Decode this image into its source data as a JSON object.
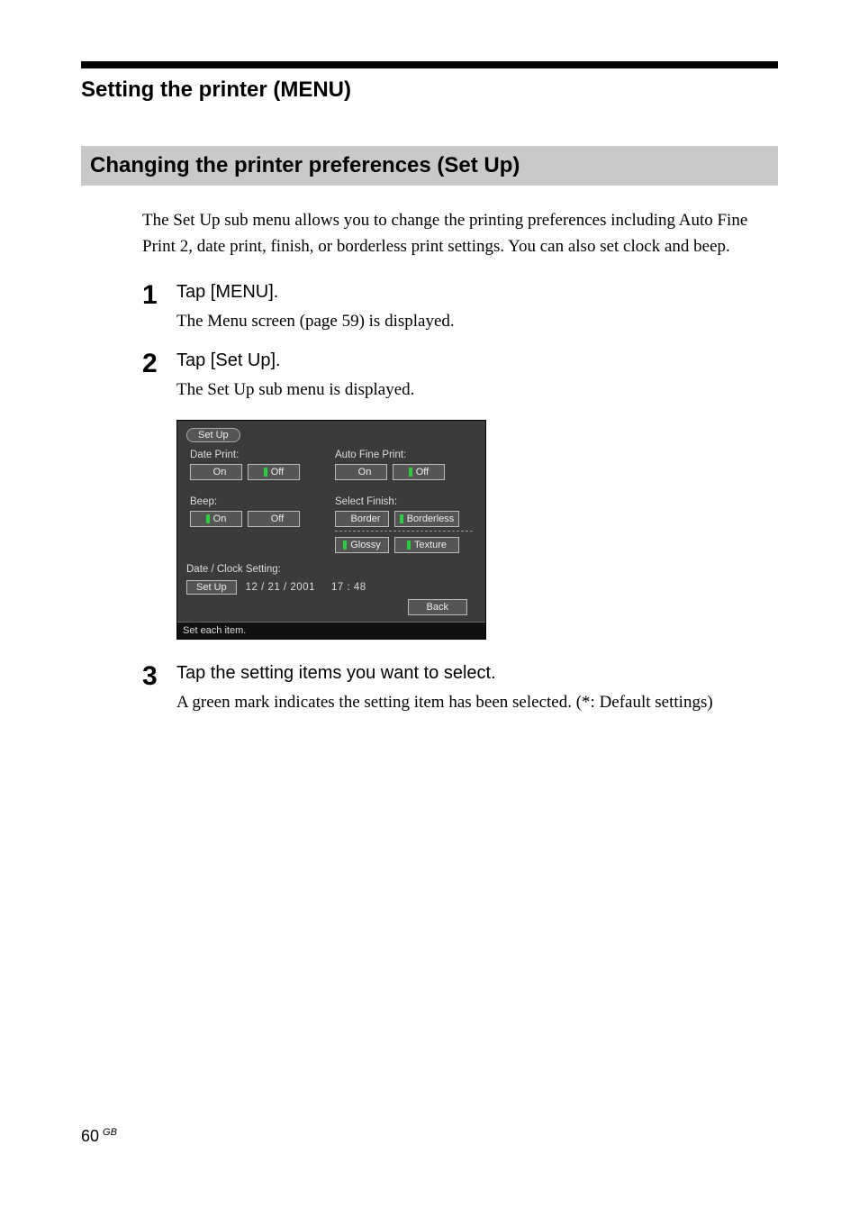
{
  "chapter_title": "Setting the printer (MENU)",
  "section_title": "Changing the printer preferences (Set Up)",
  "intro": "The Set Up sub menu allows you to change the printing preferences including Auto Fine Print 2, date print, finish, or borderless print settings.  You can also set clock and beep.",
  "steps": [
    {
      "num": "1",
      "title": "Tap [MENU].",
      "desc": "The Menu screen (page 59) is displayed."
    },
    {
      "num": "2",
      "title": "Tap [Set Up].",
      "desc": "The Set Up sub menu is displayed."
    },
    {
      "num": "3",
      "title": "Tap the setting items you want to select.",
      "desc": "A green mark indicates the setting item has been selected.  (*:  Default settings)"
    }
  ],
  "screen": {
    "tab": "Set Up",
    "date_print_label": "Date Print:",
    "auto_fine_label": "Auto Fine Print:",
    "beep_label": "Beep:",
    "finish_label": "Select Finish:",
    "on": "On",
    "off": "Off",
    "border": "Border",
    "borderless": "Borderless",
    "glossy": "Glossy",
    "texture": "Texture",
    "date_clock_label": "Date / Clock Setting:",
    "setup_btn": "Set Up",
    "date_value": "12 / 21 / 2001",
    "time_value": "17 : 48",
    "back": "Back",
    "status": "Set each item."
  },
  "page_number": "60",
  "page_region": "GB"
}
